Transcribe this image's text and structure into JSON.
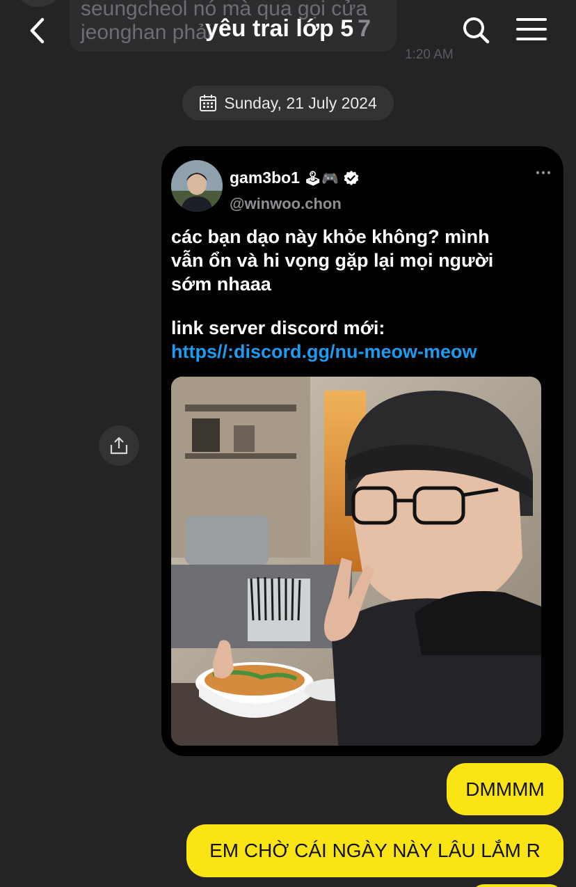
{
  "header": {
    "title": "yêu trai lớp 5",
    "member_count": "7",
    "back_icon": "chevron-left-icon",
    "search_icon": "search-icon",
    "menu_icon": "menu-icon"
  },
  "previous_message": {
    "text": "seungcheol nó mà qua gọi cửa\njeonghan phải",
    "time": "1:20 AM"
  },
  "date_divider": {
    "icon": "calendar-icon",
    "label": "Sunday, 21 July 2024"
  },
  "shared_image": {
    "share_icon": "share-icon",
    "tweet": {
      "display_name": "gam3bo1",
      "name_emojis": "🕹🎮",
      "verified_icon": "verified-badge-icon",
      "handle": "@winwoo.chon",
      "more_icon": "more-dots-icon",
      "body": "các bạn dạo này khỏe không? mình\nvẫn ổn và hi vọng gặp lại mọi người\nsớm nhaaa",
      "link_label": "link server discord mới:",
      "link": "https//:discord.gg/nu-meow-meow"
    }
  },
  "messages": [
    {
      "text": "DMMMM"
    },
    {
      "text": "EM CHỜ CÁI NGÀY NÀY LÂU LẮM R"
    }
  ],
  "colors": {
    "background": "#242426",
    "bubble": "#fbe414",
    "link": "#1d9bf0",
    "pill": "#333336"
  }
}
